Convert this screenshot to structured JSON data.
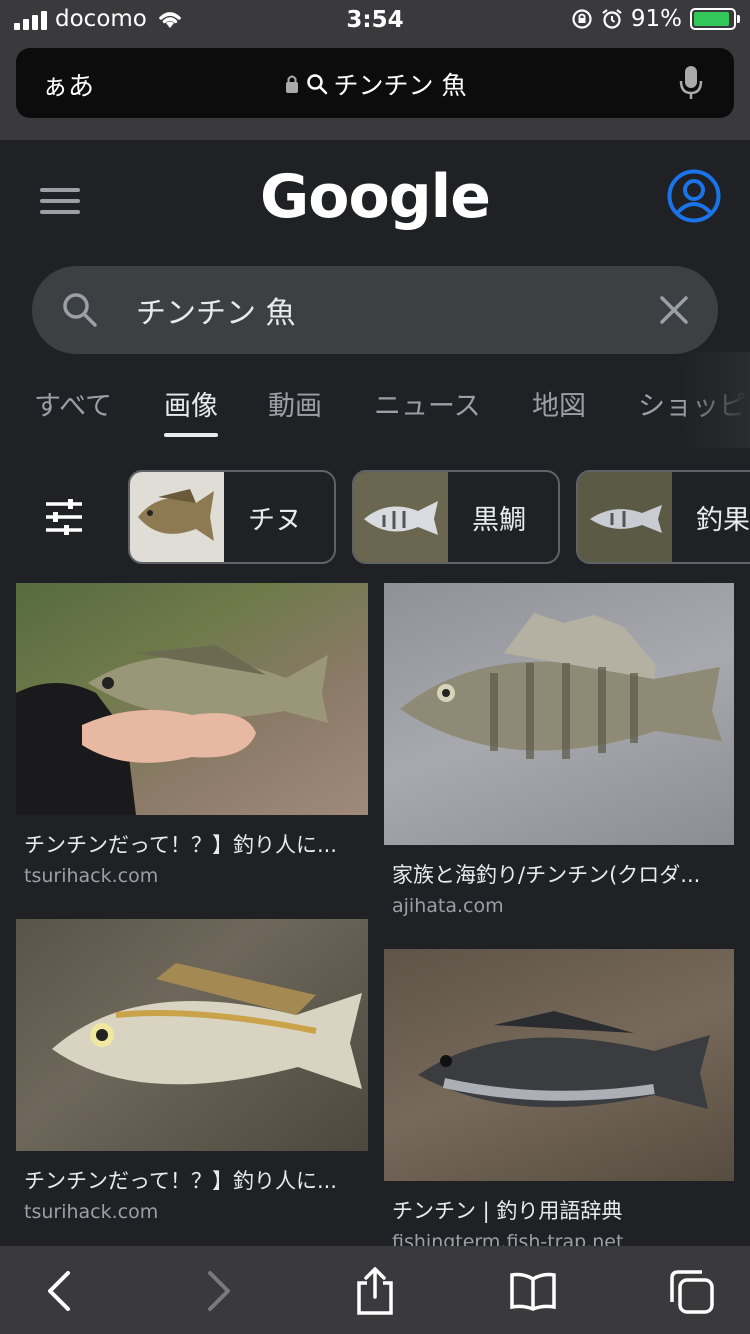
{
  "status_bar": {
    "carrier": "docomo",
    "time": "3:54",
    "battery_percent": "91%",
    "battery_level": 0.91
  },
  "url_bar": {
    "text_size_label": "ぁあ",
    "query": "チンチン 魚",
    "icons": [
      "lock-icon",
      "search-icon",
      "microphone-icon"
    ]
  },
  "google": {
    "logo": "Google",
    "search_value": "チンチン 魚",
    "tabs": [
      "すべて",
      "画像",
      "動画",
      "ニュース",
      "地図",
      "ショッピ"
    ],
    "active_tab_index": 1
  },
  "chips": [
    {
      "label": "チヌ"
    },
    {
      "label": "黒鯛"
    },
    {
      "label": "釣果"
    }
  ],
  "results": [
    {
      "title": "チンチンだって！？】釣り人に...",
      "source": "tsurihack.com"
    },
    {
      "title": "家族と海釣り/チンチン(クロダ...",
      "source": "ajihata.com"
    },
    {
      "title": "チンチンだって！？】釣り人に...",
      "source": "tsurihack.com"
    },
    {
      "title": "チンチン | 釣り用語辞典",
      "source": "fishingterm.fish-trap.net"
    }
  ],
  "colors": {
    "background": "#202124",
    "search_box": "#3c4043",
    "accent_blue": "#1a73e8",
    "safari_chrome": "#3a3a3c"
  }
}
